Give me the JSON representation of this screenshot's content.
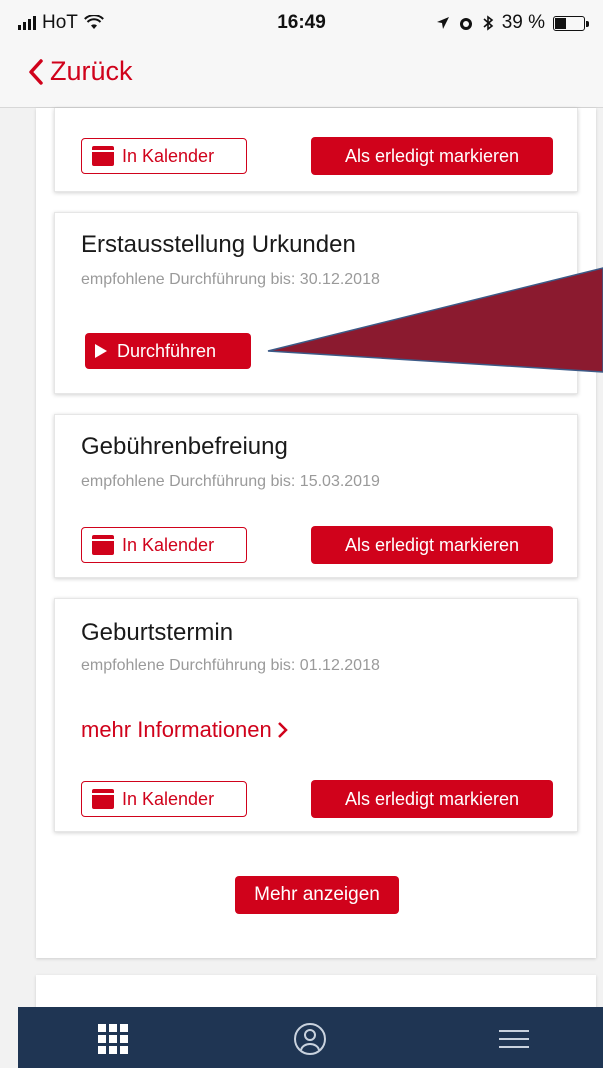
{
  "status_bar": {
    "carrier": "HoT",
    "time": "16:49",
    "battery": "39 %"
  },
  "nav": {
    "back_label": "Zurück"
  },
  "cards": [
    {
      "calendar_label": "In Kalender",
      "done_label": "Als erledigt markieren"
    },
    {
      "title": "Erstausstellung Urkunden",
      "subtitle": "empfohlene Durchführung bis: 30.12.2018",
      "action_label": "Durchführen"
    },
    {
      "title": "Gebührenbefreiung",
      "subtitle": "empfohlene Durchführung bis: 15.03.2019",
      "calendar_label": "In Kalender",
      "done_label": "Als erledigt markieren"
    },
    {
      "title": "Geburtstermin",
      "subtitle": "empfohlene Durchführung bis: 01.12.2018",
      "more_info": "mehr Informationen",
      "calendar_label": "In Kalender",
      "done_label": "Als erledigt markieren"
    }
  ],
  "more_button": "Mehr anzeigen",
  "tabs": [
    "grid-icon",
    "profile-icon",
    "menu-icon"
  ],
  "colors": {
    "accent": "#d0021b",
    "tabbar": "#1f3553",
    "annotation": "#8b1a2f"
  }
}
